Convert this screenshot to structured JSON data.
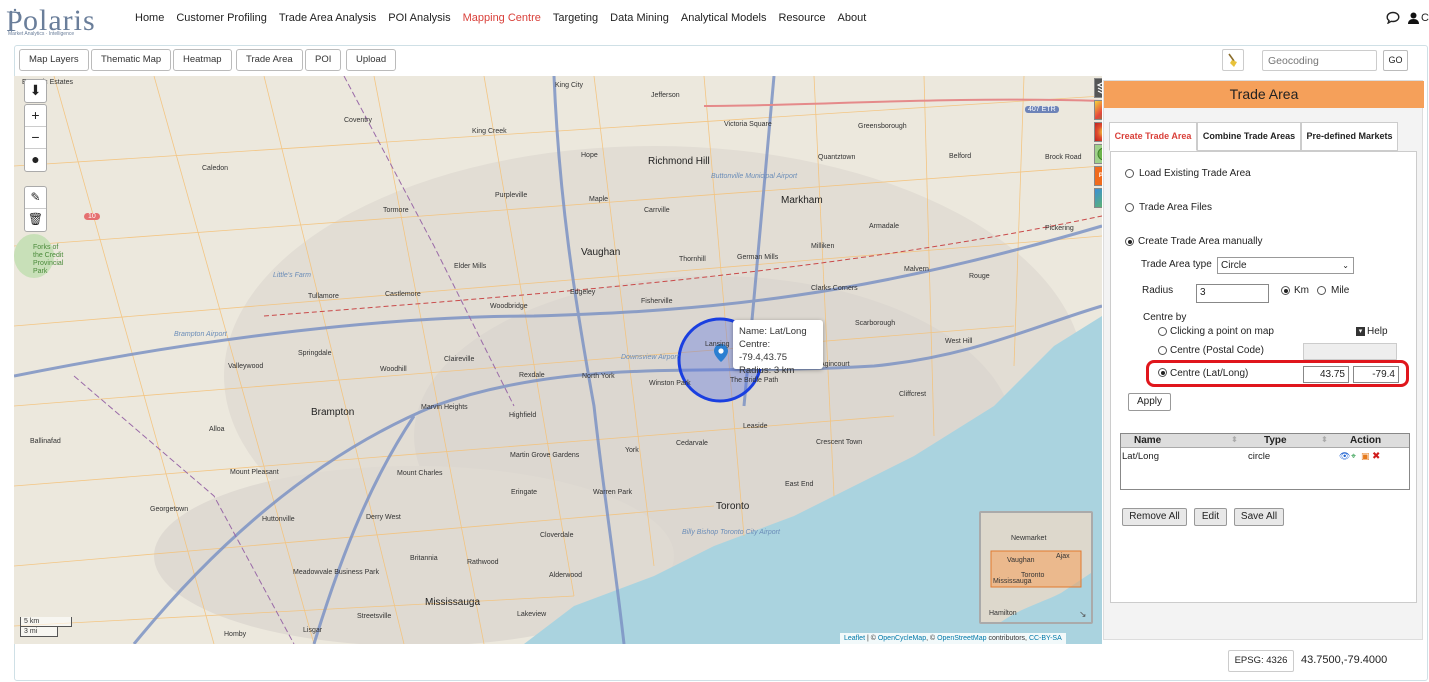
{
  "brand": {
    "name": "olaris",
    "subtitle": "Market Analytics · Intelligence"
  },
  "nav": {
    "items": [
      "Home",
      "Customer Profiling",
      "Trade Area Analysis",
      "POI Analysis",
      "Mapping Centre",
      "Targeting",
      "Data Mining",
      "Analytical Models",
      "Resource",
      "About"
    ],
    "active": "Mapping Centre",
    "user_initial": "C"
  },
  "toolbar": {
    "buttons": [
      "Map Layers",
      "Thematic Map",
      "Heatmap",
      "Trade Area",
      "POI",
      "Upload"
    ],
    "geocode_placeholder": "Geocoding",
    "go_label": "GO"
  },
  "map": {
    "labels": {
      "king_city": "King City",
      "jefferson": "Jefferson",
      "coventry": "Coventry",
      "king_creek": "King Creek",
      "victoria_square": "Victoria Square",
      "greensborough": "Greensborough",
      "hope": "Hope",
      "richmond_hill": "Richmond Hill",
      "quantztown": "Quantztown",
      "belford": "Belford",
      "brock_road": "Brock Road",
      "caledon": "Caledon",
      "buttonville": "Buttonville Municipal Airport",
      "purpleville": "Purpleville",
      "maple": "Maple",
      "carrville": "Carrville",
      "markham": "Markham",
      "tormore": "Tormore",
      "armadale": "Armadale",
      "pickering": "Pickering",
      "vaughan": "Vaughan",
      "milliken": "Milliken",
      "thornhill": "Thornhill",
      "german_mills": "German Mills",
      "elder_mills": "Elder Mills",
      "malvern": "Malvern",
      "rouge": "Rouge",
      "littles_farm": "Little's Farm",
      "tullamore": "Tullamore",
      "castlemore": "Castlemore",
      "edgeley": "Edgeley",
      "fisherville": "Fisherville",
      "clarks_corners": "Clarks Corners",
      "woodbridge": "Woodbridge",
      "scarborough": "Scarborough",
      "brampton_airport": "Brampton Airport",
      "springdale": "Springdale",
      "claireville": "Claireville",
      "downsview": "Downsview Airport",
      "west_hill": "West Hill",
      "valleywood": "Valleywood",
      "woodhill": "Woodhill",
      "rexdale": "Rexdale",
      "north_york": "North York",
      "winston_park": "Winston Park",
      "the_bridle_path": "The Bridle Path",
      "lansing": "Lansing",
      "agincourt": "Agincourt",
      "cliffcrest": "Cliffcrest",
      "brampton": "Brampton",
      "marvin_heights": "Marvin Heights",
      "highfield": "Highfield",
      "leaside": "Leaside",
      "ballinafad": "Ballinafad",
      "alloa": "Alloa",
      "cedarvale": "Cedarvale",
      "crescent_town": "Crescent Town",
      "mount_pleasant": "Mount Pleasant",
      "mount_charles": "Mount Charles",
      "martin_grove": "Martin Grove Gardens",
      "york": "York",
      "georgetown": "Georgetown",
      "eringate": "Eringate",
      "warren_park": "Warren Park",
      "east_end": "East End",
      "toronto": "Toronto",
      "huttonville": "Huttonville",
      "derry_west": "Derry West",
      "billy_bishop": "Billy Bishop Toronto City Airport",
      "cloverdale": "Cloverdale",
      "britannia": "Britannia",
      "rathwood": "Rathwood",
      "meadowvale": "Meadowvale Business Park",
      "alderwood": "Alderwood",
      "mississauga": "Mississauga",
      "streetsville": "Streetsville",
      "lakeview": "Lakeview",
      "homby": "Homby",
      "lisgar": "Lisgar",
      "forks_credit": "Forks of the Credit Provincial Park",
      "estates": "Emeraic Estates",
      "hwy407": "407 ETR",
      "hwy10": "10"
    },
    "popup": {
      "name": "Name: Lat/Long",
      "centre": "Centre: -79.4,43.75",
      "radius": "Radius: 3 km"
    },
    "scale": {
      "km": "5 km",
      "mi": "3 mi"
    },
    "minimap_labels": {
      "newmarket": "Newmarket",
      "vaughan": "Vaughan",
      "ajax": "Ajax",
      "toronto": "Toronto",
      "mississauga": "Mississauga",
      "hamilton": "Hamilton"
    },
    "attribution": {
      "leaflet": "Leaflet",
      "sep1": " | © ",
      "ocm": "OpenCycleMap",
      "sep2": ", © ",
      "osm": "OpenStreetMap",
      "contrib": " contributors, ",
      "license": "CC-BY-SA"
    }
  },
  "panel": {
    "title": "Trade Area",
    "tabs": [
      "Create Trade Area",
      "Combine Trade Areas",
      "Pre-defined Markets"
    ],
    "options": {
      "load_existing": "Load Existing Trade Area",
      "files": "Trade Area Files",
      "create_manual": "Create Trade Area manually"
    },
    "type_label": "Trade Area type",
    "type_value": "Circle",
    "radius_label": "Radius",
    "radius_value": "3",
    "unit_km": "Km",
    "unit_mile": "Mile",
    "centre_by": "Centre by",
    "centre_click": "Clicking a point on map",
    "help": "Help",
    "centre_postal": "Centre (Postal Code)",
    "centre_latlong": "Centre (Lat/Long)",
    "lat_value": "43.75",
    "long_value": "-79.4",
    "apply": "Apply",
    "table": {
      "headers": [
        "Name",
        "Type",
        "Action"
      ],
      "rows": [
        {
          "name": "Lat/Long",
          "type": "circle"
        }
      ]
    },
    "buttons": {
      "remove_all": "Remove All",
      "edit": "Edit",
      "save_all": "Save All"
    }
  },
  "status": {
    "epsg": "EPSG: 4326",
    "coords": "43.7500,-79.4000"
  },
  "colors": {
    "accent": "#d9403a",
    "panel_header": "#f5a05a",
    "circle": "#1a3fe0",
    "highlight": "#e0161c",
    "water": "#aad3df"
  }
}
